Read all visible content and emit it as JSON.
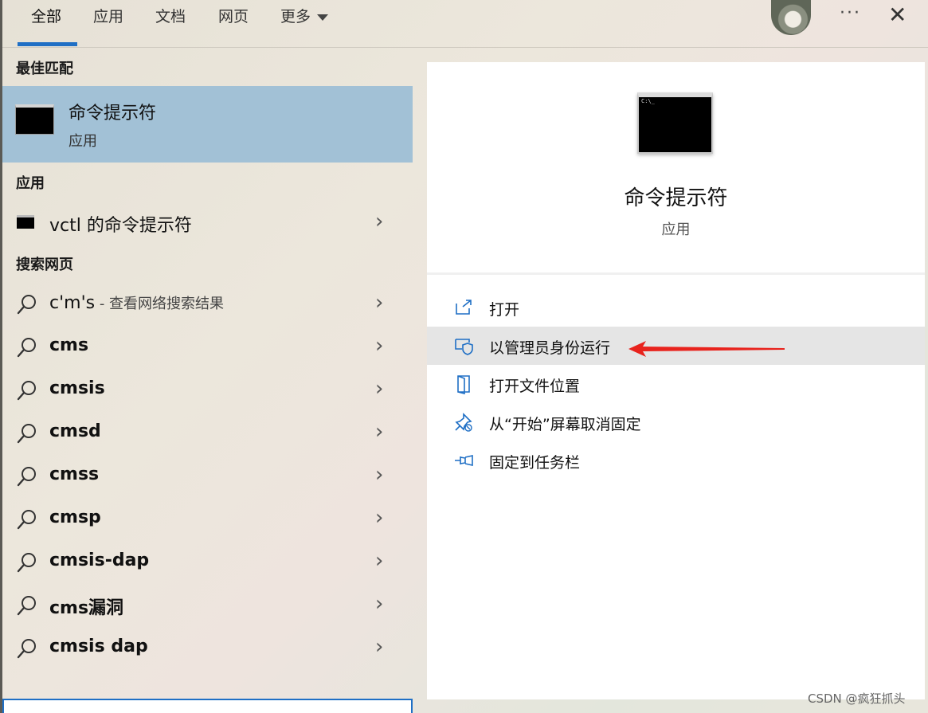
{
  "tabs": [
    {
      "label": "全部",
      "active": true
    },
    {
      "label": "应用",
      "active": false
    },
    {
      "label": "文档",
      "active": false
    },
    {
      "label": "网页",
      "active": false
    },
    {
      "label": "更多",
      "active": false
    }
  ],
  "header": {
    "more_menu_icon": "ellipsis-icon",
    "close_icon": "close-icon"
  },
  "best_match": {
    "heading": "最佳匹配",
    "title": "命令提示符",
    "subtitle": "应用"
  },
  "apps": {
    "heading": "应用",
    "items": [
      {
        "label": "vctl 的命令提示符"
      }
    ]
  },
  "web": {
    "heading": "搜索网页",
    "items": [
      {
        "query": "c'm's",
        "suffix": " - 查看网络搜索结果"
      },
      {
        "query": "cms",
        "suffix": ""
      },
      {
        "query": "cmsis",
        "suffix": ""
      },
      {
        "query": "cmsd",
        "suffix": ""
      },
      {
        "query": "cmss",
        "suffix": ""
      },
      {
        "query": "cmsp",
        "suffix": ""
      },
      {
        "query": "cmsis-dap",
        "suffix": ""
      },
      {
        "query": "cms漏洞",
        "suffix": ""
      },
      {
        "query": "cmsis dap",
        "suffix": ""
      }
    ]
  },
  "detail": {
    "title": "命令提示符",
    "subtitle": "应用",
    "icon_prompt": "C:\\_",
    "actions": [
      {
        "label": "打开",
        "icon": "open-icon",
        "highlighted": false
      },
      {
        "label": "以管理员身份运行",
        "icon": "admin-shield-icon",
        "highlighted": true
      },
      {
        "label": "打开文件位置",
        "icon": "folder-location-icon",
        "highlighted": false
      },
      {
        "label": "从“开始”屏幕取消固定",
        "icon": "unpin-icon",
        "highlighted": false
      },
      {
        "label": "固定到任务栏",
        "icon": "pin-taskbar-icon",
        "highlighted": false
      }
    ]
  },
  "annotation": {
    "color": "#e8231d"
  },
  "colors": {
    "accent": "#1f6fc5",
    "selection": "#a2c1d6"
  },
  "watermark": "CSDN @疯狂抓头"
}
